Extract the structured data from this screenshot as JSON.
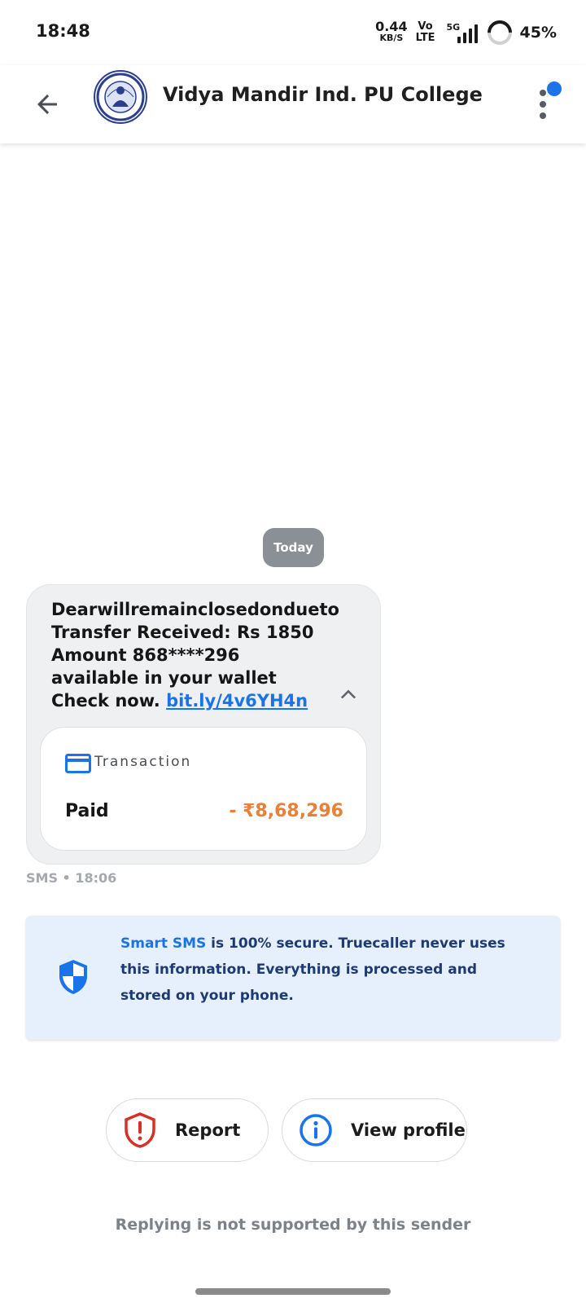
{
  "status_bar": {
    "time": "18:48",
    "net_speed": "0.44",
    "net_speed_unit": "KB/S",
    "volte_top": "Vo",
    "volte_bottom": "LTE",
    "network": "5G",
    "battery": "45%"
  },
  "header": {
    "sender_name": "Vidya Mandir Ind. PU College"
  },
  "conversation": {
    "date_chip": "Today",
    "message": {
      "text": "Dearwillremainclosedondueto Transfer Received: Rs 1850 Amount 868****296 available in your wallet Check now. ",
      "link": "bit.ly/4v6YH4n",
      "transaction": {
        "label": "Transaction",
        "status": "Paid",
        "amount": "- ₹8,68,296"
      },
      "meta": "SMS • 18:06"
    }
  },
  "secure_note": {
    "highlight": "Smart SMS",
    "text": " is 100% secure. Truecaller never uses this information. Everything is processed and stored on your phone."
  },
  "actions": {
    "report_label": "Report",
    "profile_label": "View profile"
  },
  "footer": {
    "reply_note": "Replying is not supported by this sender"
  },
  "colors": {
    "accent": "#1a73e8",
    "amount": "#e8803a",
    "report_red": "#d93025",
    "note_bg": "#e6f0fd"
  }
}
